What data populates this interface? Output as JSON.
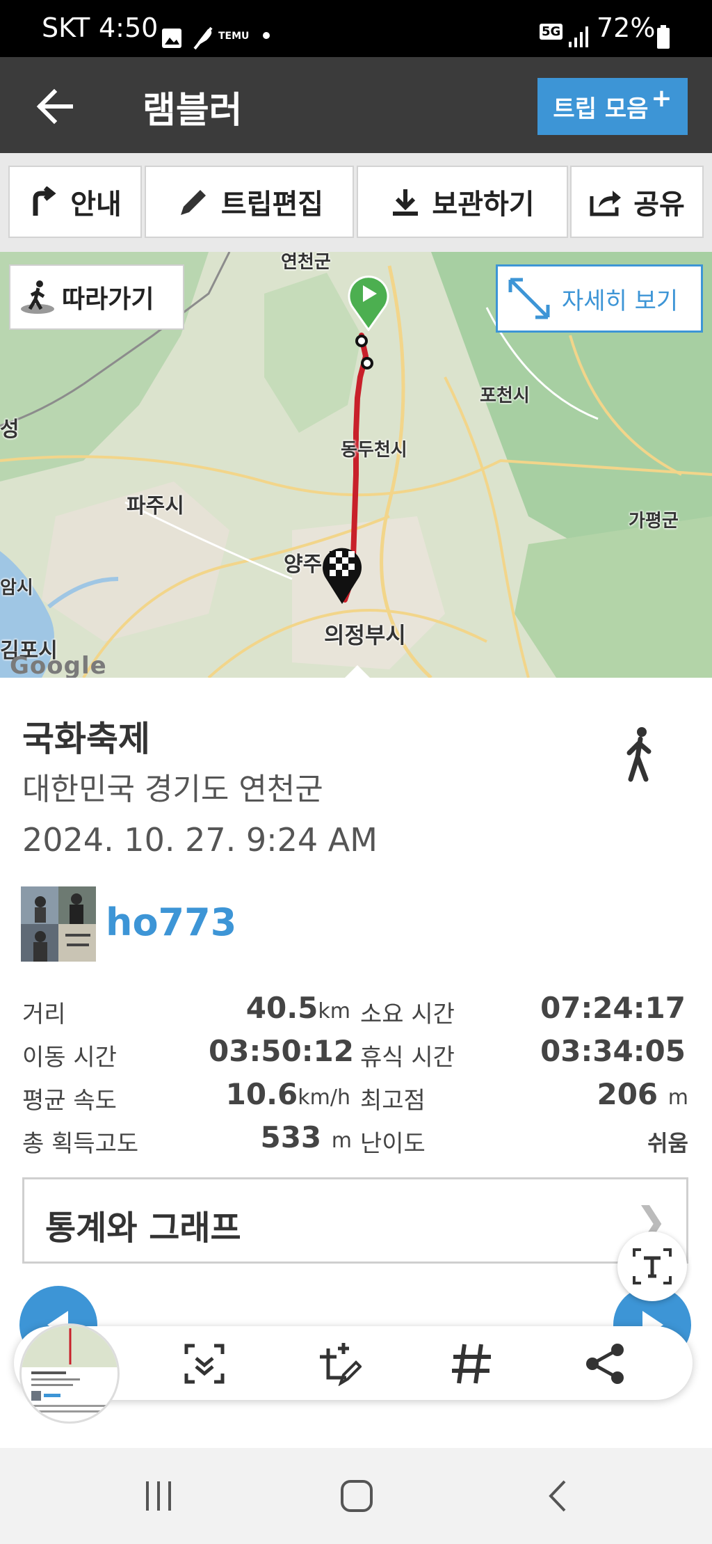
{
  "status_bar": {
    "carrier": "SKT",
    "time": "4:50",
    "notif_app": "TEMU",
    "network": "5G",
    "battery": "72%"
  },
  "header": {
    "title": "램블러",
    "trip_button": "트립 모음",
    "trip_button_plus": "+"
  },
  "toolbar": {
    "guide": "안내",
    "edit": "트립편집",
    "save": "보관하기",
    "share": "공유"
  },
  "map": {
    "follow": "따라가기",
    "detail": "자세히 보기",
    "labels": {
      "yeoncheon": "연천군",
      "pocheon": "포천시",
      "dongducheon": "동두천시",
      "paju": "파주시",
      "yangju": "양주",
      "uijeongbu": "의정부시",
      "gapyeong": "가평군",
      "seong": "성",
      "amsi": "암시",
      "gimpo": "김포시"
    },
    "attribution": "Google",
    "route_color": "#c8202a"
  },
  "trip": {
    "name": "국화축제",
    "location": "대한민국 경기도 연천군",
    "date": "2024. 10. 27. 9:24 AM",
    "user": "ho773",
    "activity_icon": "walking-icon"
  },
  "stats": {
    "distance_label": "거리",
    "distance": "40.5",
    "distance_unit": "km",
    "duration_label": "소요 시간",
    "duration": "07:24:17",
    "moving_label": "이동 시간",
    "moving": "03:50:12",
    "rest_label": "휴식 시간",
    "rest": "03:34:05",
    "speed_label": "평균 속도",
    "speed": "10.6",
    "speed_unit": "km/h",
    "max_alt_label": "최고점",
    "max_alt": "206",
    "max_alt_unit": "m",
    "gain_label": "총 획득고도",
    "gain": "533",
    "gain_unit": "m",
    "difficulty_label": "난이도",
    "difficulty": "쉬움"
  },
  "graph_section": {
    "label": "통계와 그래프",
    "chevron": "❯"
  },
  "smart_select": {
    "icons": [
      "scan-icon",
      "edit-crop-icon",
      "hashtag-icon",
      "share-icon"
    ],
    "text_icon": "text-extract-icon"
  },
  "colors": {
    "accent": "#3d95d6",
    "header_bg": "#3b3b3b"
  }
}
